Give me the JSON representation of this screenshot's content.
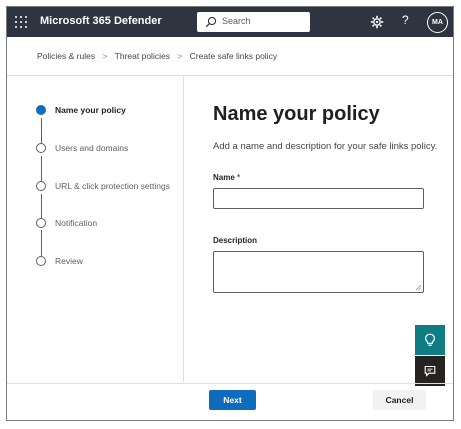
{
  "app": {
    "title": "Microsoft 365 Defender",
    "search_placeholder": "Search",
    "help_glyph": "?",
    "avatar_initials": "MA"
  },
  "breadcrumb": {
    "items": [
      "Policies & rules",
      "Threat policies",
      "Create safe links policy"
    ],
    "separator": ">"
  },
  "wizard": {
    "steps": [
      {
        "label": "Name your policy",
        "state": "current"
      },
      {
        "label": "Users and domains",
        "state": "pending"
      },
      {
        "label": "URL & click protection settings",
        "state": "pending"
      },
      {
        "label": "Notification",
        "state": "pending"
      },
      {
        "label": "Review",
        "state": "pending"
      }
    ]
  },
  "main": {
    "title": "Name your policy",
    "description": "Add a name and description for your safe links policy.",
    "name_label": "Name",
    "name_required_mark": "*",
    "name_value": "",
    "description_label": "Description",
    "description_value": ""
  },
  "footer": {
    "next_label": "Next",
    "cancel_label": "Cancel"
  },
  "colors": {
    "topbar": "#2f3441",
    "accent": "#0f6cbd",
    "teal_button": "#107c83",
    "dark_button": "#252423",
    "required": "#c4314b"
  },
  "icons": {
    "app_launcher": "waffle-icon",
    "search": "search-icon",
    "settings": "gear-icon",
    "help": "help-icon",
    "assistant": "lightbulb-icon",
    "feedback": "chat-icon"
  }
}
